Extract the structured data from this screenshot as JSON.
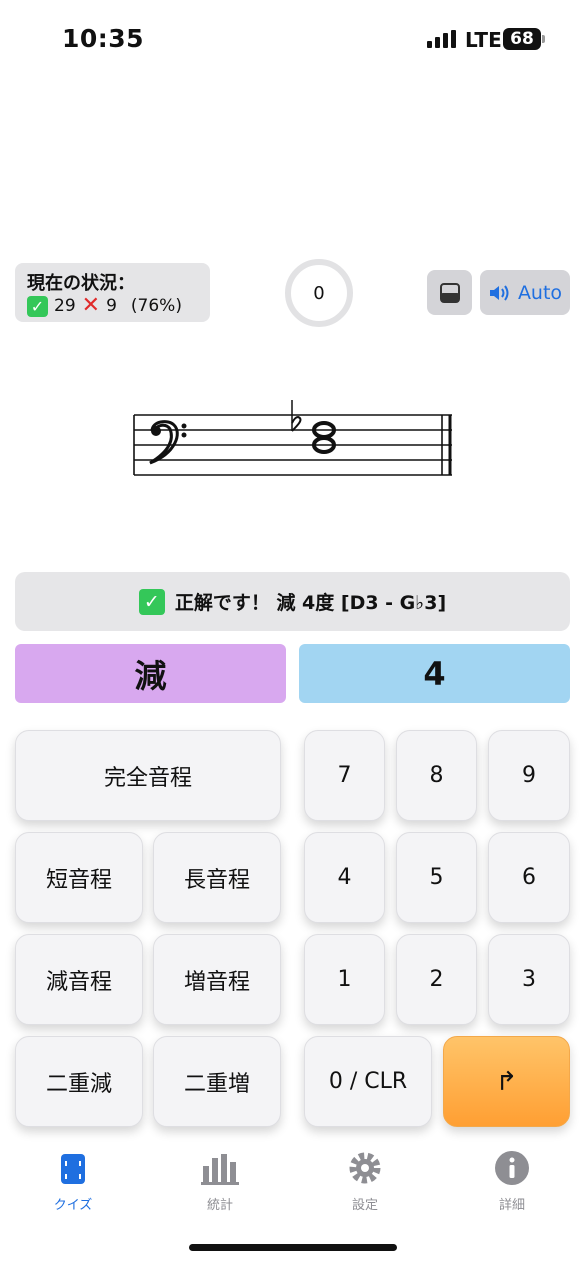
{
  "status_bar": {
    "time": "10:35",
    "network": "LTE",
    "battery": "68"
  },
  "score": {
    "title": "現在の状況：",
    "correct": "29",
    "wrong": "9",
    "percent": "(76%)"
  },
  "timer": {
    "value": "0"
  },
  "controls": {
    "auto_label": "Auto"
  },
  "feedback": {
    "text": "正解です！ 減 4度 [D3 - G♭3]"
  },
  "answer": {
    "quality": "減",
    "number": "4"
  },
  "keypad": {
    "perfect": "完全音程",
    "minor": "短音程",
    "major": "長音程",
    "diminished": "減音程",
    "augmented": "増音程",
    "double_dim": "二重減",
    "double_aug": "二重増",
    "k7": "7",
    "k8": "8",
    "k9": "9",
    "k4": "4",
    "k5": "5",
    "k6": "6",
    "k1": "1",
    "k2": "2",
    "k3": "3",
    "clear": "0 / CLR",
    "next": "↱"
  },
  "tabs": [
    {
      "label": "クイズ",
      "icon": "quiz-icon",
      "active": true
    },
    {
      "label": "統計",
      "icon": "chart-icon",
      "active": false
    },
    {
      "label": "設定",
      "icon": "gear-icon",
      "active": false
    },
    {
      "label": "詳細",
      "icon": "info-icon",
      "active": false
    }
  ],
  "colors": {
    "accent": "#1f6fe0",
    "quality_bg": "#d8a8ef",
    "number_bg": "#a2d5f2",
    "next_bg": "#ff9f33",
    "correct": "#34c759",
    "wrong": "#e02a2a"
  }
}
